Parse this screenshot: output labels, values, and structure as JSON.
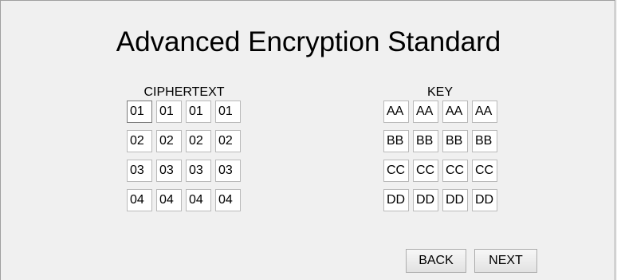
{
  "title": "Advanced Encryption Standard",
  "ciphertext": {
    "label": "CIPHERTEXT",
    "rows": [
      [
        "01",
        "01",
        "01",
        "01"
      ],
      [
        "02",
        "02",
        "02",
        "02"
      ],
      [
        "03",
        "03",
        "03",
        "03"
      ],
      [
        "04",
        "04",
        "04",
        "04"
      ]
    ]
  },
  "key": {
    "label": "KEY",
    "rows": [
      [
        "AA",
        "AA",
        "AA",
        "AA"
      ],
      [
        "BB",
        "BB",
        "BB",
        "BB"
      ],
      [
        "CC",
        "CC",
        "CC",
        "CC"
      ],
      [
        "DD",
        "DD",
        "DD",
        "DD"
      ]
    ]
  },
  "buttons": {
    "back": "BACK",
    "next": "NEXT"
  }
}
